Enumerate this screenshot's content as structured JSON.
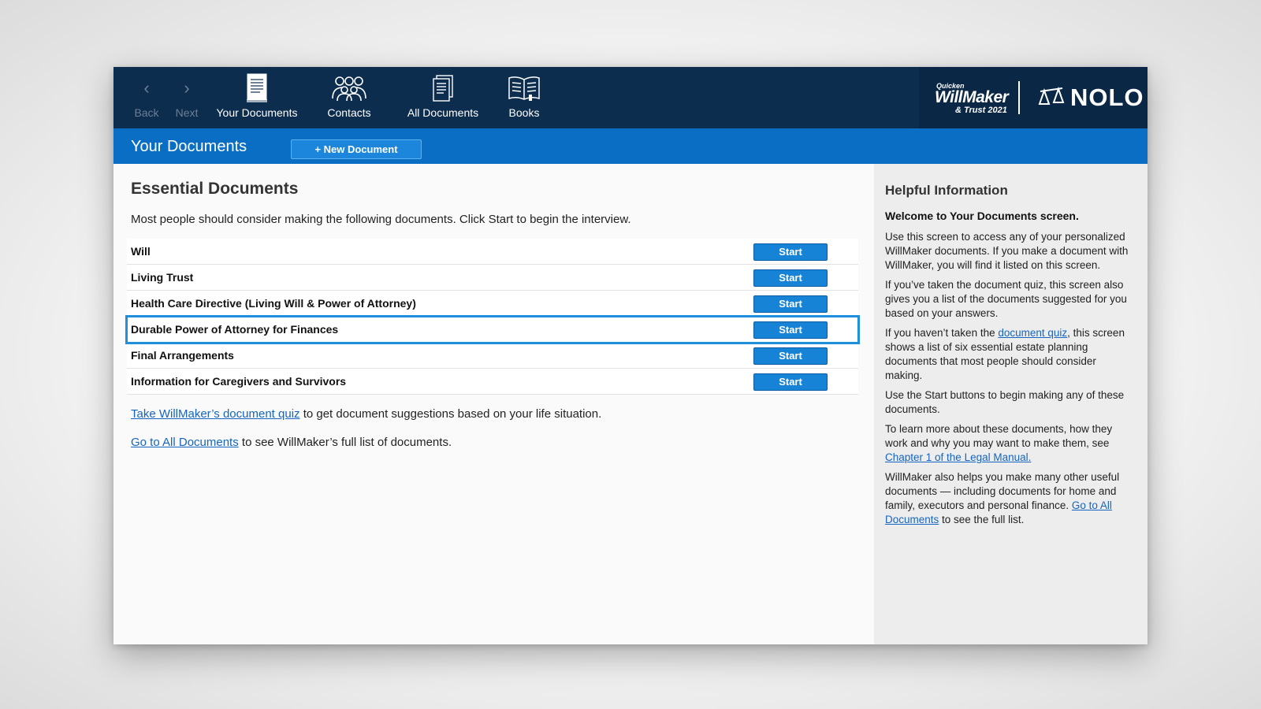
{
  "toolbar": {
    "back_label": "Back",
    "next_label": "Next",
    "your_documents_label": "Your Documents",
    "contacts_label": "Contacts",
    "all_documents_label": "All Documents",
    "books_label": "Books"
  },
  "brand": {
    "quicken": "Quicken",
    "willmaker": "WillMaker",
    "edition": "& Trust 2021",
    "nolo": "NOLO"
  },
  "titlebar": {
    "title": "Your Documents",
    "new_document_label": "+ New Document"
  },
  "main": {
    "heading": "Essential Documents",
    "intro": "Most people should consider making the following documents. Click Start to begin the interview.",
    "start_label": "Start",
    "documents": [
      {
        "name": "Will"
      },
      {
        "name": "Living Trust"
      },
      {
        "name": "Health Care Directive (Living Will & Power of Attorney)"
      },
      {
        "name": "Durable Power of Attorney for Finances"
      },
      {
        "name": "Final Arrangements"
      },
      {
        "name": "Information for Caregivers and Survivors"
      }
    ],
    "quiz_link": "Take WillMaker’s document quiz",
    "quiz_text": " to get document suggestions based on your life situation.",
    "all_docs_link": "Go to All Documents",
    "all_docs_text": " to see WillMaker’s full list of documents."
  },
  "help": {
    "title": "Helpful Information",
    "welcome": "Welcome to Your Documents screen.",
    "p1": "Use this screen to access any of your personalized WillMaker documents. If you make a document with WillMaker, you will find it listed on this screen.",
    "p2": "If you’ve taken the document quiz, this screen also gives you a list of the documents suggested for you based on your answers.",
    "p3_before": "If you haven’t taken the ",
    "p3_link": "document quiz",
    "p3_after": ", this screen shows a list of six essential estate planning documents that most people should consider making.",
    "p4": "Use the Start buttons to begin making any of these documents.",
    "p5_before": "To learn more about these documents, how they work and why you may want to make them, see ",
    "p5_link": "Chapter 1 of the Legal Manual.",
    "p6_before": "WillMaker also helps you make many other useful documents — including documents for home and family, executors and personal finance. ",
    "p6_link": "Go to All Documents",
    "p6_after": " to see the full list."
  },
  "colors": {
    "toolbar_bg": "#0d2d4f",
    "titlebar_bg": "#0a6fc4",
    "start_button": "#1783d6",
    "selection_outline": "#1e8fdc",
    "link": "#1565c0"
  }
}
